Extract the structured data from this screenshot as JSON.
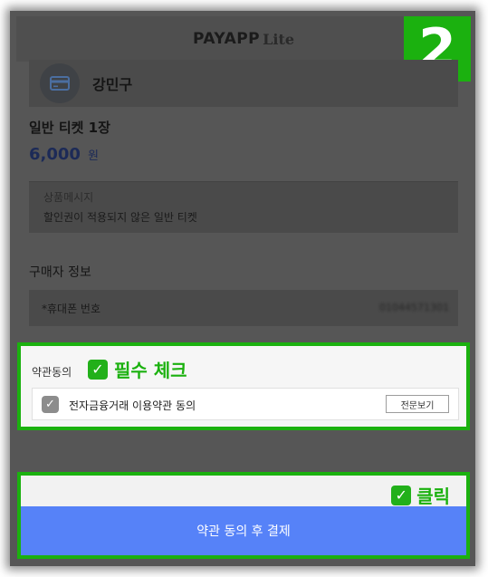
{
  "header": {
    "logo": "PAYAPP",
    "logo_suffix": "Lite"
  },
  "step_badge": "2",
  "payer": {
    "icon": "credit-card-icon",
    "name": "강민구"
  },
  "product": {
    "title": "일반 티켓 1장",
    "price": "6,000",
    "currency": "원"
  },
  "message": {
    "label": "상품메시지",
    "text": "할인권이 적용되지 않은 일반 티켓"
  },
  "buyer": {
    "section_title": "구매자 정보",
    "phone_label": "*휴대폰 번호",
    "phone_value": "01044571301"
  },
  "agreement": {
    "title": "약관동의",
    "annotation": "필수 체크",
    "item_label": "전자금융거래 이용약관 동의",
    "view_button": "전문보기"
  },
  "payment": {
    "annotation": "클릭",
    "button_label": "약관 동의 후 결제"
  },
  "colors": {
    "annotation_green": "#1bb10f",
    "pay_blue": "#5682f8"
  }
}
